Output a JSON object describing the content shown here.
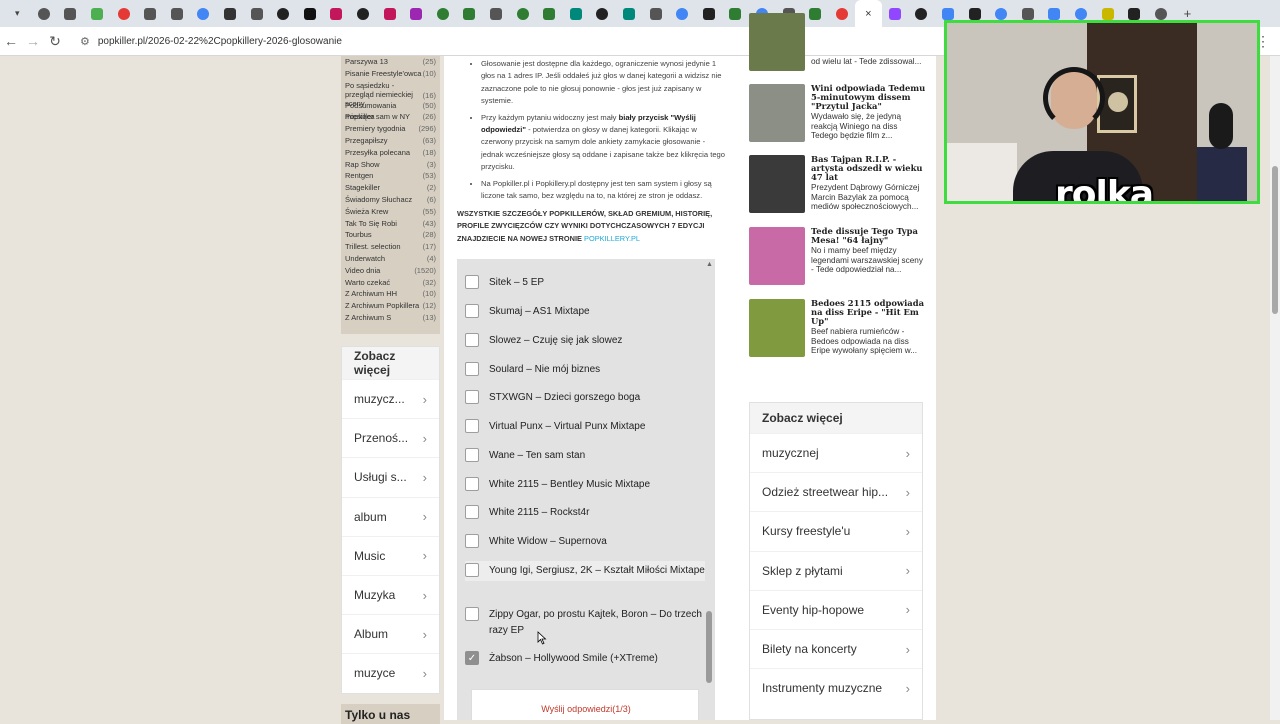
{
  "browser": {
    "tab_icon_colors": [
      "#555",
      "#555",
      "#4caf50",
      "#e53935",
      "#555",
      "#555",
      "#4285f4",
      "#333",
      "#555",
      "#222",
      "#111",
      "#c2185b",
      "#222",
      "#c2185b",
      "#9c27b0",
      "#2e7d32",
      "#2e7d32",
      "#555",
      "#2e7d32",
      "#2e7d32",
      "#00897b",
      "#222",
      "#00897b",
      "#555",
      "#4285f4",
      "#222",
      "#2e7d32",
      "#4285f4",
      "#555",
      "#2e7d32",
      "#e53935",
      "#ffffff",
      "#9146ff",
      "#222",
      "#4285f4",
      "#222",
      "#4285f4",
      "#555",
      "#4285f4",
      "#4285f4",
      "#c9b700",
      "#222",
      "#555"
    ],
    "active_tab_close": "×",
    "new_tab": "+",
    "back": "←",
    "forward": "→",
    "reload": "↻",
    "url": "popkiller.pl/2026-02-22%2Cpopkillery-2026-glosowanie",
    "menu": "⋮"
  },
  "categories": [
    {
      "name": "Parszywa 13",
      "count": "(25)"
    },
    {
      "name": "Pisanie Freestyle'owca",
      "count": "(10)"
    },
    {
      "name": "Po sąsiedzku - przegląd niemieckiej sceny",
      "count": "(16)"
    },
    {
      "name": "Podsumowania miesiąca",
      "count": "(50)"
    },
    {
      "name": "Popkiller sam w NY",
      "count": "(26)"
    },
    {
      "name": "Premiery tygodnia",
      "count": "(296)"
    },
    {
      "name": "Przegapiłszy",
      "count": "(63)"
    },
    {
      "name": "Przesyłka polecana",
      "count": "(18)"
    },
    {
      "name": "Rap Show",
      "count": "(3)"
    },
    {
      "name": "Rentgen",
      "count": "(53)"
    },
    {
      "name": "Stagekiller",
      "count": "(2)"
    },
    {
      "name": "Świadomy Słuchacz",
      "count": "(6)"
    },
    {
      "name": "Świeża Krew",
      "count": "(55)"
    },
    {
      "name": "Tak To Się Robi",
      "count": "(43)"
    },
    {
      "name": "Tourbus",
      "count": "(28)"
    },
    {
      "name": "Trillest. selection",
      "count": "(17)"
    },
    {
      "name": "Underwatch",
      "count": "(4)"
    },
    {
      "name": "Video dnia",
      "count": "(1520)"
    },
    {
      "name": "Warto czekać",
      "count": "(32)"
    },
    {
      "name": "Z Archiwum HH",
      "count": "(10)"
    },
    {
      "name": "Z Archiwum Popkillera",
      "count": "(12)"
    },
    {
      "name": "Z Archiwum S",
      "count": "(13)"
    }
  ],
  "left_more": {
    "title": "Zobacz więcej",
    "items": [
      "muzycz...",
      "Przenoś...",
      "Usługi s...",
      "album",
      "Music",
      "Muzyka",
      "Album",
      "muzyce"
    ]
  },
  "left_tylko": "Tylko u nas",
  "bullets": {
    "b1": "Głosowanie jest dostępne dla każdego, ograniczenie wynosi jedynie 1 głos na 1 adres IP. Jeśli oddałeś już głos w danej kategorii a widzisz nie zaznaczone pole to nie głosuj ponownie - głos jest już zapisany w systemie.",
    "b2_pre": "Przy każdym pytaniu widoczny jest mały ",
    "b2_bold": "biały przycisk \"Wyślij odpowiedzi\"",
    "b2_post": " - potwierdza on głosy w danej kategorii. Klikając w czerwony przycisk na samym dole ankiety zamykacie głosowanie - jednak wcześniejsze głosy są oddane i zapisane także bez klikręcia tego przycisku.",
    "b3": "Na Popkiller.pl i Popkillery.pl dostępny jest ten sam system i głosy są liczone tak samo, bez względu na to, na której ze stron je oddasz."
  },
  "allcaps_text": "Wszystkie szczegóły Popkillerów, skład gremium, historię, profile zwycięzców czy wyniki dotychczasowych 7 edycji znajdziecie na nowej stronie ",
  "allcaps_link": "popkillery.pl",
  "poll": {
    "options": [
      {
        "label": "Sitek – 5 EP",
        "checked": false
      },
      {
        "label": "Skumaj – AS1 Mixtape",
        "checked": false
      },
      {
        "label": "Slowez – Czuję się jak slowez",
        "checked": false
      },
      {
        "label": "Soulard – Nie mój biznes",
        "checked": false
      },
      {
        "label": "STXWGN – Dzieci gorszego boga",
        "checked": false
      },
      {
        "label": "Virtual Punx – Virtual Punx Mixtape",
        "checked": false
      },
      {
        "label": "Wane – Ten sam stan",
        "checked": false
      },
      {
        "label": "White 2115 – Bentley Music Mixtape",
        "checked": false
      },
      {
        "label": "White 2115 – Rockst4r",
        "checked": false
      },
      {
        "label": "White Widow – Supernova",
        "checked": false
      },
      {
        "label": "Young Igi, Sergiusz, 2K – Kształt Miłości Mixtape",
        "checked": false
      },
      {
        "label": "Zippy Ogar, po prostu Kajtek, Boron – Do trzech razy EP",
        "checked": false
      },
      {
        "label": "Żabson – Hollywood Smile (+XTreme)",
        "checked": true
      }
    ],
    "submit_label": "Wyślij odpowiedzi(1/3)",
    "checkmark": "✓"
  },
  "news": [
    {
      "title": "",
      "desc": "od wielu lat - Tede zdissowal...",
      "thumb": "#6b7a4a"
    },
    {
      "title": "Wini odpowiada Tedemu 5-minutowym dissem \"Przytul Jacka\"",
      "desc": "Wydawało się, że jedyną reakcją Winiego na diss Tedego będzie film z...",
      "thumb": "#8b8f86"
    },
    {
      "title": "Bas Tajpan R.I.P. - artysta odszedł w wieku 47 lat",
      "desc": "Prezydent Dąbrowy Górniczej Marcin Bazylak za pomocą mediów społecznościowych...",
      "thumb": "#3a3a3a"
    },
    {
      "title": "Tede dissuje Tego Typa Mesa! \"64 łajny\"",
      "desc": "No i mamy beef między legendami warszawskiej sceny - Tede odpowiedział na...",
      "thumb": "#c86aa6"
    },
    {
      "title": "Bedoes 2115 odpowiada na diss Eripe - \"Hit Em Up\"",
      "desc": "Beef nabiera rumieńców - Bedoes odpowiada na diss Eripe wywołany spięciem w...",
      "thumb": "#7f9a3f"
    }
  ],
  "right_more": {
    "title": "Zobacz więcej",
    "items": [
      "muzycznej",
      "Odzież streetwear hip...",
      "Kursy freestyle'u",
      "Sklep z płytami",
      "Eventy hip-hopowe",
      "Bilety na koncerty",
      "Instrumenty muzyczne"
    ]
  },
  "webcam_caption": "rolka",
  "chevron": "›"
}
